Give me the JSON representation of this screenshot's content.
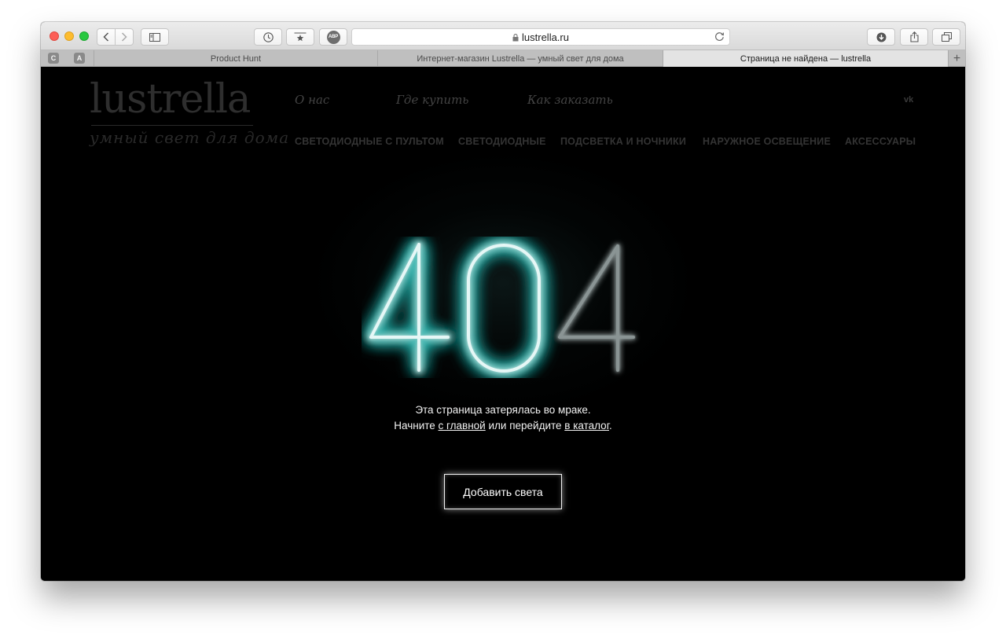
{
  "browser": {
    "address": "lustrella.ru",
    "pinned_tabs": [
      "C",
      "A"
    ],
    "tabs": [
      {
        "title": "Product Hunt"
      },
      {
        "title": "Интернет-магазин Lustrella — умный свет для дома"
      },
      {
        "title": "Страница не найдена — lustrella",
        "active": true
      }
    ],
    "new_tab": "+",
    "abp_label": "ABP"
  },
  "site": {
    "logo_word": "lustrella",
    "logo_tagline": "умный свет для дома",
    "nav_top": [
      "О нас",
      "Где купить",
      "Как заказать"
    ],
    "social_icon": "vk",
    "categories": [
      "СВЕТОДИОДНЫЕ С ПУЛЬТОМ",
      "СВЕТОДИОДНЫЕ",
      "ПОДСВЕТКА И НОЧНИКИ",
      "НАРУЖНОЕ ОСВЕЩЕНИЕ",
      "АКСЕССУАРЫ"
    ]
  },
  "error": {
    "code": "404",
    "line1": "Эта страница затерялась во мраке.",
    "line2_start": "Начните ",
    "home_link": "с главной",
    "line2_mid": " или перейдите ",
    "catalog_link": "в каталог",
    "line2_end": ".",
    "button": "Добавить света"
  },
  "colors": {
    "neon": "#e6f7f6",
    "neon_glow": "#2fb8b2",
    "neon_dim": "#8a9494"
  }
}
